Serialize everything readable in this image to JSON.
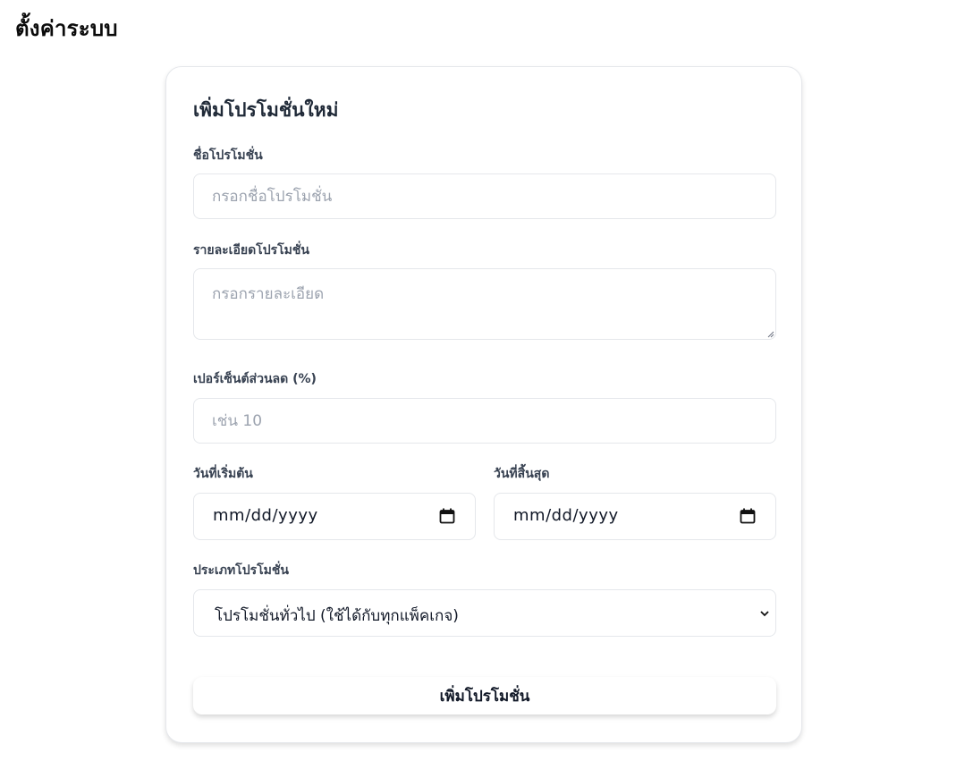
{
  "page": {
    "title": "ตั้งค่าระบบ"
  },
  "form": {
    "title": "เพิ่มโปรโมชั่นใหม่",
    "name": {
      "label": "ชื่อโปรโมชั่น",
      "placeholder": "กรอกชื่อโปรโมชั่น",
      "value": ""
    },
    "description": {
      "label": "รายละเอียดโปรโมชั่น",
      "placeholder": "กรอกรายละเอียด",
      "value": ""
    },
    "discount": {
      "label": "เปอร์เซ็นต์ส่วนลด (%)",
      "placeholder": "เช่น 10",
      "value": ""
    },
    "start_date": {
      "label": "วันที่เริ่มต้น",
      "value": "mm/dd/yyyy"
    },
    "end_date": {
      "label": "วันที่สิ้นสุด",
      "value": "mm/dd/yyyy"
    },
    "type": {
      "label": "ประเภทโปรโมชั่น",
      "selected": "โปรโมชั่นทั่วไป (ใช้ได้กับทุกแพ็คเกจ)"
    },
    "submit_label": "เพิ่มโปรโมชั่น"
  },
  "icons": {
    "calendar": "calendar-icon",
    "chevron": "chevron-down-icon",
    "resize": "resize-grip-icon"
  },
  "colors": {
    "border": "#e5e7eb",
    "placeholder": "#9ca3af",
    "text": "#111827",
    "label": "#374151"
  }
}
